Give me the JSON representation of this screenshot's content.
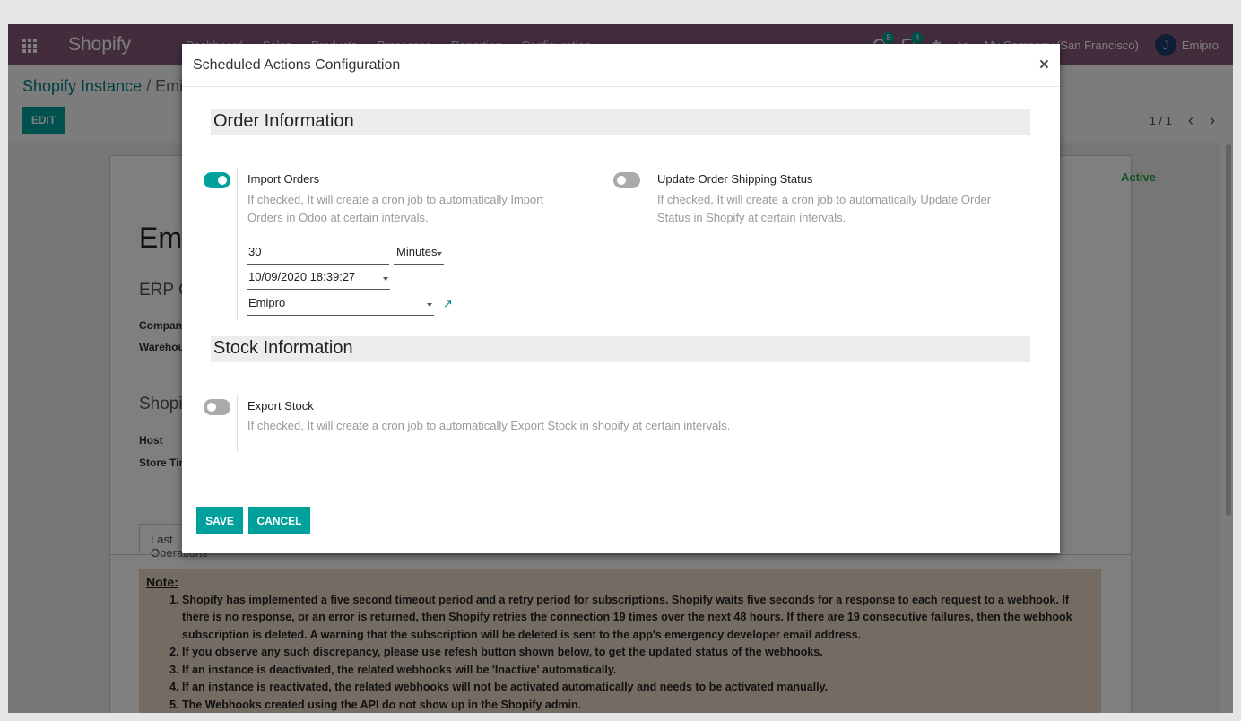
{
  "navbar": {
    "brand": "Shopify",
    "menu": [
      "Dashboard",
      "Sales",
      "Products",
      "Processes",
      "Reporting",
      "Configuration"
    ],
    "chat_count": "8",
    "activity_count": "4",
    "company": "My Company (San Francisco)",
    "user": "Emipro"
  },
  "control_panel": {
    "breadcrumb_root": "Shopify Instance",
    "breadcrumb_sep": "/",
    "breadcrumb_current": "Emipro",
    "edit_label": "EDIT",
    "pager": "1 / 1"
  },
  "background_form": {
    "status": "Active",
    "title": "Emipro",
    "erp_heading": "ERP Configuration",
    "company_label": "Company",
    "warehouse_label": "Warehouse",
    "shopify_heading": "Shopify Configuration",
    "host_label": "Host",
    "store_tz_label": "Store Time Zone",
    "tab_label": "Last Operations",
    "note_title": "Note:",
    "note_items": [
      "Shopify has implemented a five second timeout period and a retry period for subscriptions. Shopify waits five seconds for a response to each request to a webhook. If there is no response, or an error is returned, then Shopify retries the connection 19 times over the next 48 hours. If there are 19 consecutive failures, then the webhook subscription is deleted. A warning that the subscription will be deleted is sent to the app's emergency developer email address.",
      "If you observe any such discrepancy, please use refesh button shown below, to get the updated status of the webhooks.",
      "If an instance is deactivated, the related webhooks will be 'Inactive' automatically.",
      "If an instance is reactivated, the related webhooks will not be activated automatically and needs to be activated manually.",
      "The Webhooks created using the API do not show up in the Shopify admin."
    ]
  },
  "modal": {
    "title": "Scheduled Actions Configuration",
    "close": "×",
    "order_section": "Order Information",
    "import_orders": {
      "label": "Import Orders",
      "checked": true,
      "help": "If checked, It will create a cron job to automatically Import Orders in Odoo at certain intervals.",
      "interval_number": "30",
      "interval_type": "Minutes",
      "next_execution": "10/09/2020 18:39:27",
      "user": "Emipro"
    },
    "update_shipping": {
      "label": "Update Order Shipping Status",
      "checked": false,
      "help": "If checked, It will create a cron job to automatically Update Order Status in Shopify at certain intervals."
    },
    "stock_section": "Stock Information",
    "export_stock": {
      "label": "Export Stock",
      "checked": false,
      "help": "If checked, It will create a cron job to automatically Export Stock in shopify at certain intervals."
    },
    "save_label": "SAVE",
    "cancel_label": "CANCEL"
  },
  "colors": {
    "navbar": "#875a7b",
    "primary": "#00a09d",
    "note_bg": "#e8d8c6"
  }
}
